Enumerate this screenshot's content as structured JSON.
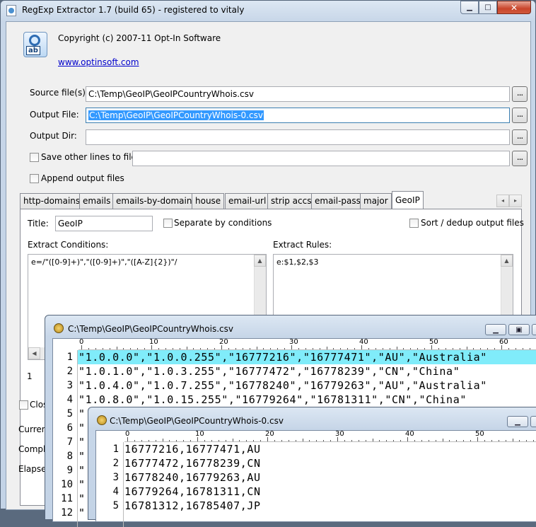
{
  "main_window": {
    "title": "RegExp Extractor 1.7 (build 65) - registered to vitaly",
    "caption_buttons": [
      "minimize",
      "maximize",
      "close"
    ],
    "app_icon_text": "ab",
    "copyright": "Copyright (c) 2007-11 Opt-In Software",
    "website": "www.optinsoft.com",
    "source_label": "Source file(s):",
    "source_value": "C:\\Temp\\GeoIP\\GeoIPCountryWhois.csv",
    "output_file_label": "Output File:",
    "output_file_value": "C:\\Temp\\GeoIP\\GeoIPCountryWhois-0.csv",
    "output_dir_label": "Output Dir:",
    "output_dir_value": "",
    "save_other_label": "Save other lines to file:",
    "save_other_value": "",
    "append_label": "Append output files",
    "browse_label": "...",
    "tabs": [
      "http-domains",
      "emails",
      "emails-by-domain",
      "house",
      "email-url",
      "strip accs",
      "email-pass",
      "major",
      "GeoIP"
    ],
    "active_tab": "GeoIP",
    "tab_scroll_left": "◂",
    "tab_scroll_right": "▸",
    "title_label": "Title:",
    "title_value": "GeoIP",
    "separate_label": "Separate by conditions",
    "sort_label": "Sort / dedup output files",
    "conditions_label": "Extract Conditions:",
    "conditions_value": "e=/\"([0-9]+)\",\"([0-9]+)\",\"([A-Z]{2})\"/",
    "rules_label": "Extract Rules:",
    "rules_value": "e:$1,$2,$3",
    "status_num": "1",
    "close_partial": "Clos",
    "current_partial": "Current",
    "complete_partial": "Comple",
    "elapsed_partial": "Elapsed"
  },
  "viewer1": {
    "title": "C:\\Temp\\GeoIP\\GeoIPCountryWhois.csv",
    "ruler_numbers": [
      "0",
      "10",
      "20",
      "30",
      "40",
      "50",
      "60"
    ],
    "lines": [
      {
        "n": "1",
        "text": "\"1.0.0.0\",\"1.0.0.255\",\"16777216\",\"16777471\",\"AU\",\"Australia\""
      },
      {
        "n": "2",
        "text": "\"1.0.1.0\",\"1.0.3.255\",\"16777472\",\"16778239\",\"CN\",\"China\""
      },
      {
        "n": "3",
        "text": "\"1.0.4.0\",\"1.0.7.255\",\"16778240\",\"16779263\",\"AU\",\"Australia\""
      },
      {
        "n": "4",
        "text": "\"1.0.8.0\",\"1.0.15.255\",\"16779264\",\"16781311\",\"CN\",\"China\""
      },
      {
        "n": "5",
        "text": "\""
      },
      {
        "n": "6",
        "text": "\""
      },
      {
        "n": "7",
        "text": "\""
      },
      {
        "n": "8",
        "text": "\""
      },
      {
        "n": "9",
        "text": "\""
      },
      {
        "n": "10",
        "text": "\""
      },
      {
        "n": "11",
        "text": "\""
      },
      {
        "n": "12",
        "text": "\""
      }
    ]
  },
  "viewer2": {
    "title": "C:\\Temp\\GeoIP\\GeoIPCountryWhois-0.csv",
    "ruler_numbers": [
      "0",
      "10",
      "20",
      "30",
      "40",
      "50"
    ],
    "lines": [
      {
        "n": "1",
        "text": "16777216,16777471,AU"
      },
      {
        "n": "2",
        "text": "16777472,16778239,CN"
      },
      {
        "n": "3",
        "text": "16778240,16779263,AU"
      },
      {
        "n": "4",
        "text": "16779264,16781311,CN"
      },
      {
        "n": "5",
        "text": "16781312,16785407,JP"
      }
    ]
  },
  "colors": {
    "selection": "#3399ff",
    "current_line": "#80ecfa",
    "link": "#0000cc"
  }
}
